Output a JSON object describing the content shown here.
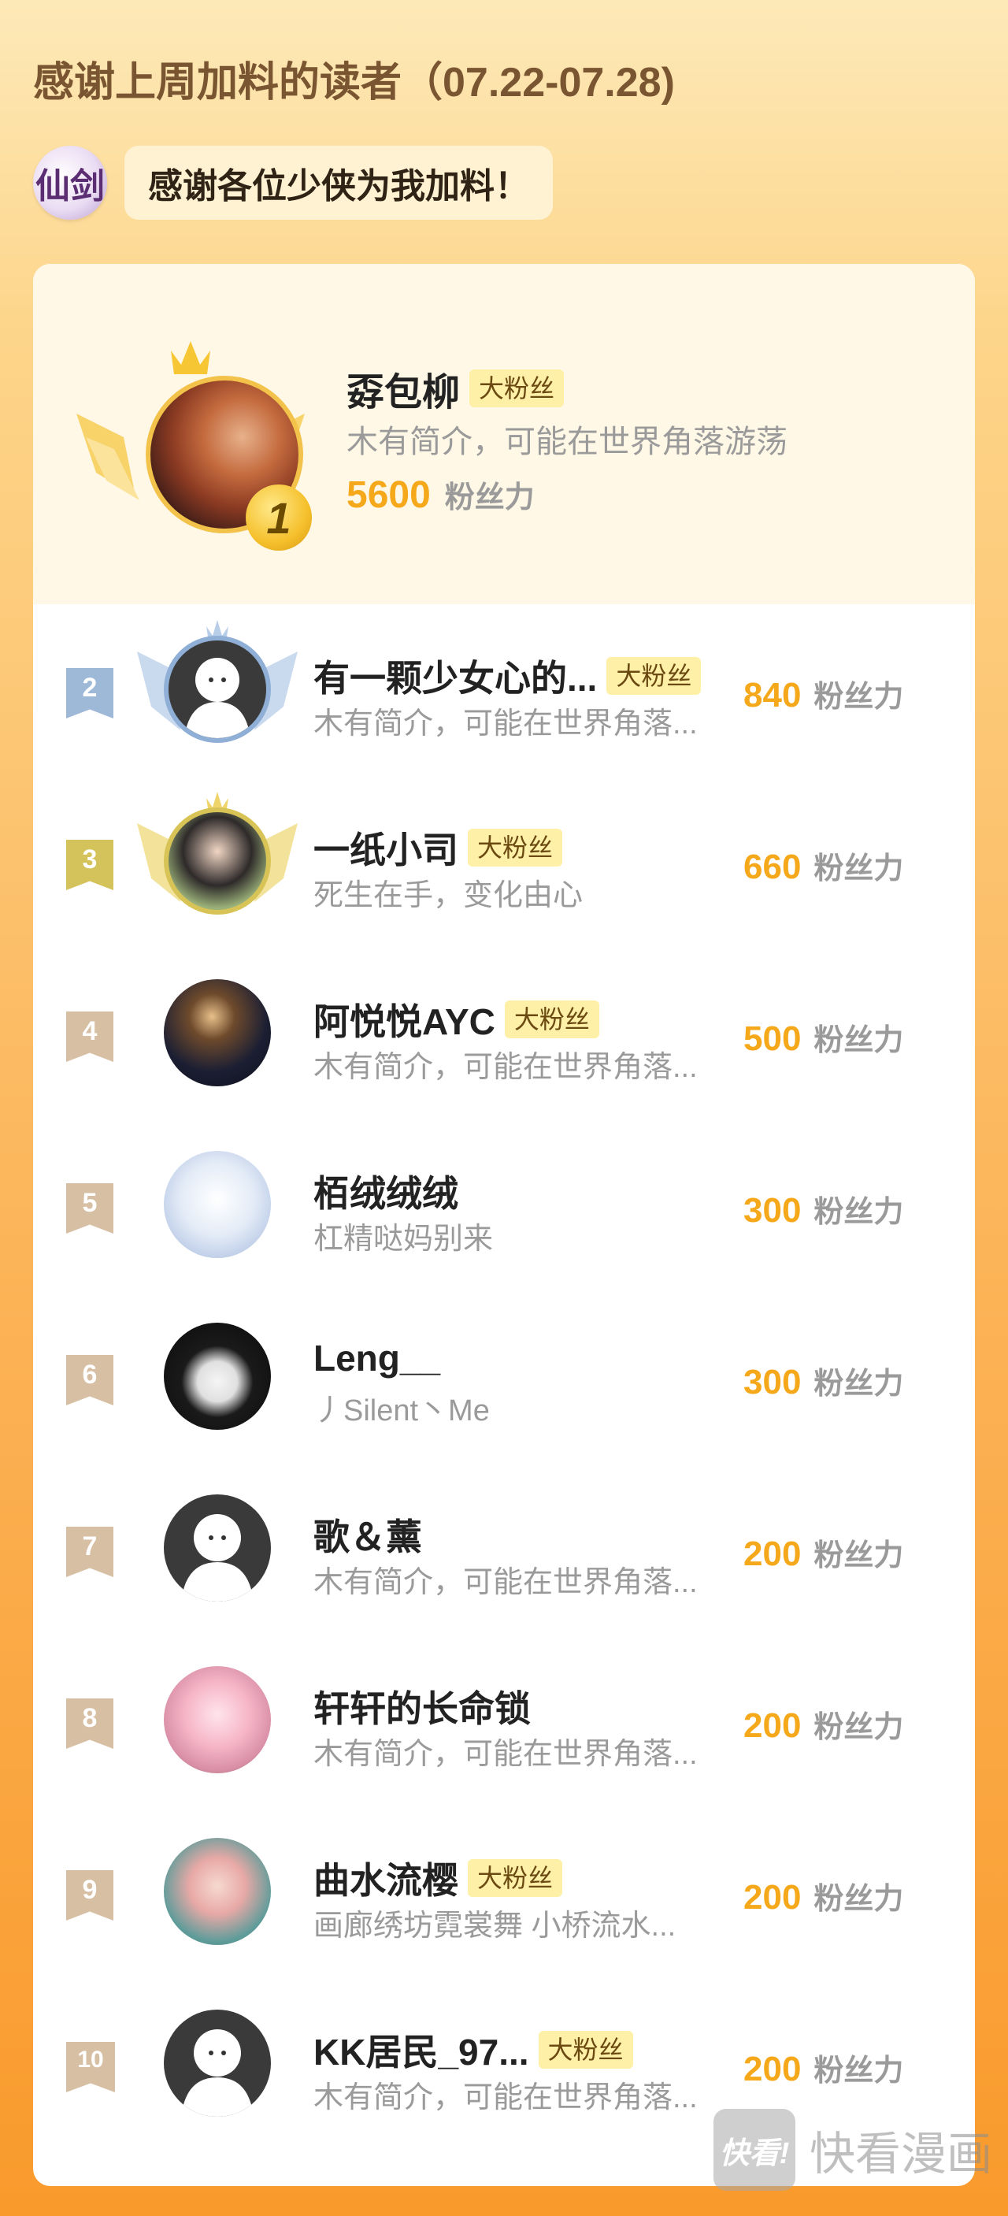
{
  "header": {
    "title": "感谢上周加料的读者（07.22-07.28)",
    "logo_text": "仙剑",
    "bubble_text": "感谢各位少侠为我加料！"
  },
  "colors": {
    "accent_orange": "#F4A81A",
    "badge_bg": "#FFF0A8",
    "rank2": "#9EB8D8",
    "rank3": "#D4C25A",
    "rank_other": "#D7BFA4"
  },
  "top_fan": {
    "rank": "1",
    "name": "孬包柳",
    "badge": "大粉丝",
    "bio": "木有简介，可能在世界角落游荡",
    "power": "5600",
    "power_unit": "粉丝力"
  },
  "fans": [
    {
      "rank": "2",
      "name": "有一颗少女心的...",
      "badge": "大粉丝",
      "bio": "木有简介，可能在世界角落...",
      "power": "840",
      "unit": "粉丝力"
    },
    {
      "rank": "3",
      "name": "一纸小司",
      "badge": "大粉丝",
      "bio": "死生在手，变化由心",
      "power": "660",
      "unit": "粉丝力"
    },
    {
      "rank": "4",
      "name": "阿悦悦AYC",
      "badge": "大粉丝",
      "bio": "木有简介，可能在世界角落...",
      "power": "500",
      "unit": "粉丝力"
    },
    {
      "rank": "5",
      "name": "栢绒绒绒",
      "bio": "杠精哒妈别来",
      "power": "300",
      "unit": "粉丝力"
    },
    {
      "rank": "6",
      "name": "Leng__",
      "bio": "丿Silent丶Me",
      "power": "300",
      "unit": "粉丝力"
    },
    {
      "rank": "7",
      "name": "歌＆薰",
      "bio": "木有简介，可能在世界角落...",
      "power": "200",
      "unit": "粉丝力"
    },
    {
      "rank": "8",
      "name": "轩轩的长命锁",
      "bio": "木有简介，可能在世界角落...",
      "power": "200",
      "unit": "粉丝力"
    },
    {
      "rank": "9",
      "name": "曲水流樱",
      "badge": "大粉丝",
      "bio": "画廊绣坊霓裳舞 小桥流水...",
      "power": "200",
      "unit": "粉丝力"
    },
    {
      "rank": "10",
      "name": "KK居民_97...",
      "badge": "大粉丝",
      "bio": "木有简介，可能在世界角落...",
      "power": "200",
      "unit": "粉丝力"
    }
  ],
  "watermark": {
    "logo_text": "快看!",
    "text": "快看漫画"
  }
}
